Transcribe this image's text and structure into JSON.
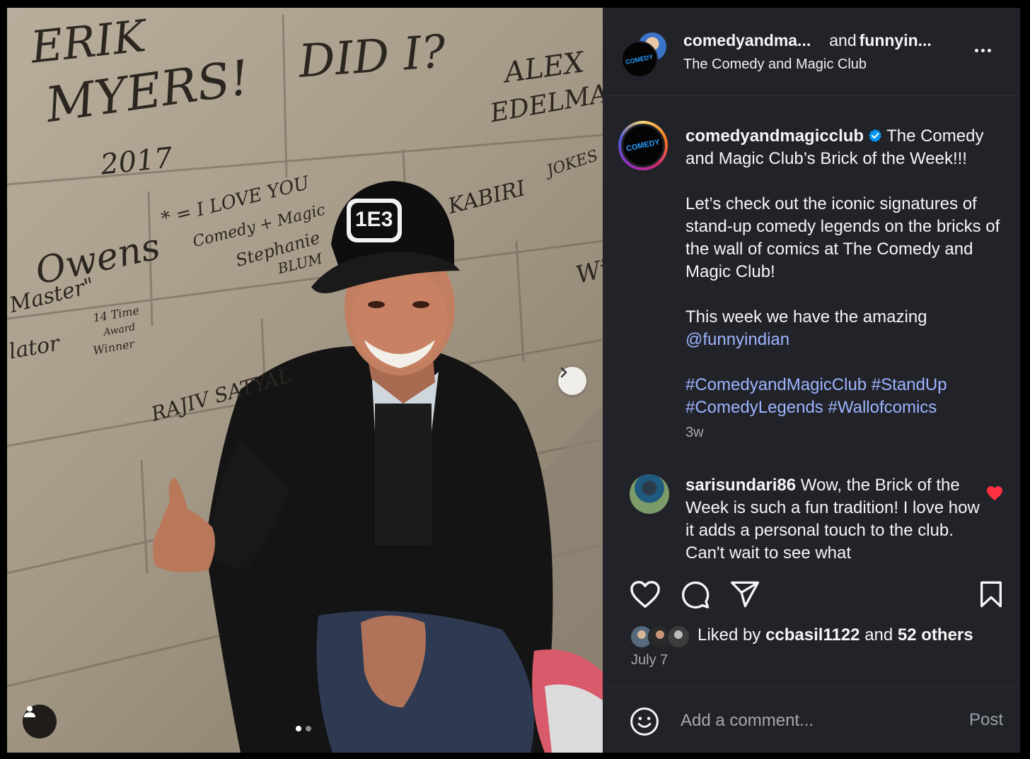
{
  "photo": {
    "description_icons": [
      "chevron-right-icon",
      "user-tag-icon"
    ],
    "graffiti": [
      "ERIK",
      "MYERS!",
      "2017",
      "DID I?",
      "ALEX",
      "EDELMAN",
      "* = I LOVE YOU",
      "Comedy + Magic",
      "Stephanie",
      "BLUM",
      "Owens",
      "Master\"",
      "lator",
      "14 Time",
      "Award",
      "Winner",
      "RAJIV SATYAL",
      "JOKES",
      "KABIRI",
      "Will"
    ],
    "cap_logo": "1E3",
    "carousel_index": 1,
    "carousel_count": 2
  },
  "header": {
    "user1": "comedyandma...",
    "and_label": "and",
    "user2": "funnyin...",
    "subtitle": "The Comedy and Magic Club",
    "logo_text": "COMEDY"
  },
  "caption": {
    "username": "comedyandmagicclub",
    "line1": "The Comedy and Magic Club’s Brick of the Week!!!",
    "para2": "Let’s check out the iconic signatures of stand-up comedy legends on the bricks of the wall of comics at The Comedy and Magic Club!",
    "para3_prefix": "This week we have the amazing",
    "mention": "@funnyindian",
    "hashtags": [
      "#ComedyandMagicClub",
      "#StandUp",
      "#ComedyLegends",
      "#Wallofcomics"
    ],
    "time": "3w"
  },
  "comment": {
    "username": "sarisundari86",
    "text": "Wow, the Brick of the Week is such a fun tradition! I love how it adds a personal touch to the club. Can't wait to see what"
  },
  "likes": {
    "prefix": "Liked by",
    "user": "ccbasil1122",
    "middle": "and",
    "others": "52 others"
  },
  "date": "July 7",
  "comment_bar": {
    "placeholder": "Add a comment...",
    "post_label": "Post"
  },
  "colors": {
    "panel_bg": "#222329",
    "link": "#9db4ff",
    "heart_red": "#ff3040",
    "verified": "#0095f6"
  }
}
